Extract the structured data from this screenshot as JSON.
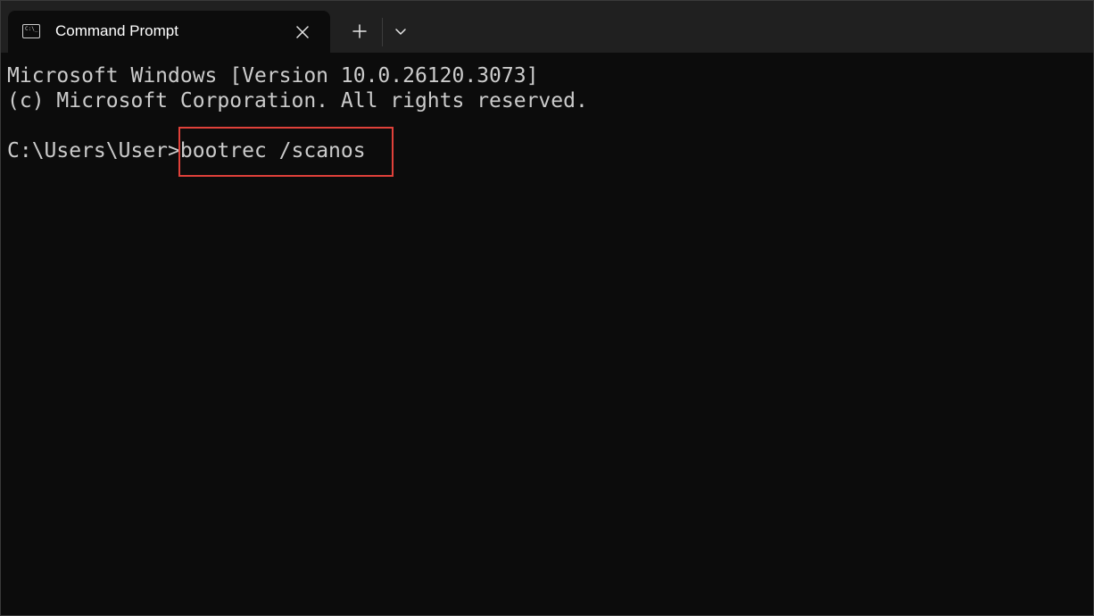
{
  "window": {
    "tab": {
      "title": "Command Prompt",
      "icon": "cmd-icon",
      "icon_text": "C:\\_"
    },
    "controls": {
      "close_icon": "close-icon",
      "new_tab_icon": "plus-icon",
      "dropdown_icon": "chevron-down-icon"
    }
  },
  "terminal": {
    "lines": [
      "Microsoft Windows [Version 10.0.26120.3073]",
      "(c) Microsoft Corporation. All rights reserved."
    ],
    "prompt": "C:\\Users\\User>",
    "command": "bootrec /scanos"
  },
  "colors": {
    "terminal_bg": "#0c0c0c",
    "text": "#cccccc",
    "highlight_border": "#e0413a",
    "tabstrip_bg": "#202020"
  }
}
